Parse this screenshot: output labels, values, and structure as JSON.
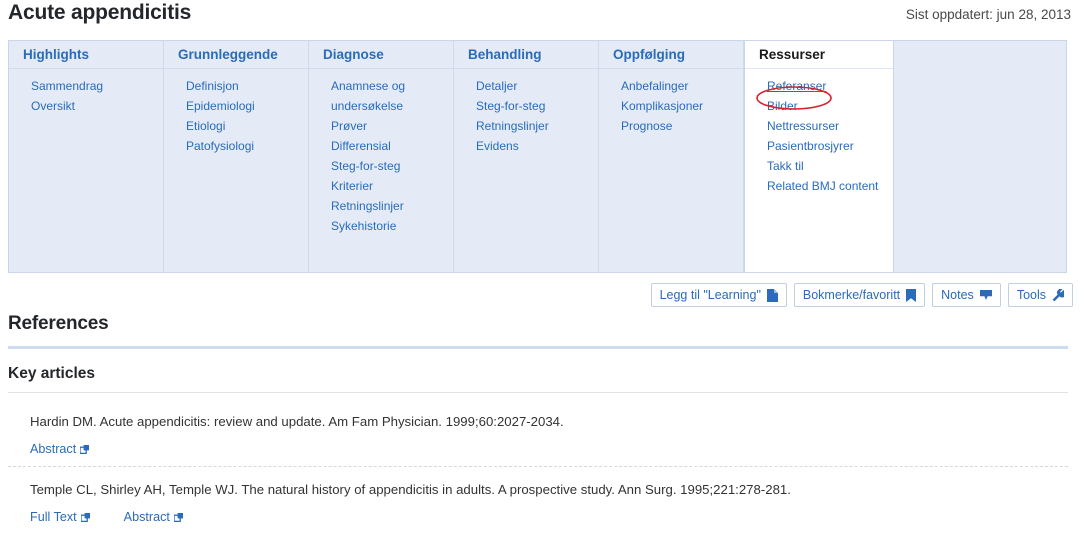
{
  "header": {
    "title": "Acute appendicitis",
    "last_updated": "Sist oppdatert: jun 28, 2013"
  },
  "nav_panel": {
    "columns": [
      {
        "heading": "Highlights",
        "active": false,
        "links": [
          "Sammendrag",
          "Oversikt"
        ]
      },
      {
        "heading": "Grunnleggende",
        "active": false,
        "links": [
          "Definisjon",
          "Epidemiologi",
          "Etiologi",
          "Patofysiologi"
        ]
      },
      {
        "heading": "Diagnose",
        "active": false,
        "links": [
          "Anamnese og",
          "undersøkelse",
          "Prøver",
          "Differensial",
          "Steg-for-steg",
          "Kriterier",
          "Retningslinjer",
          "Sykehistorie"
        ]
      },
      {
        "heading": "Behandling",
        "active": false,
        "links": [
          "Detaljer",
          "Steg-for-steg",
          "Retningslinjer",
          "Evidens"
        ]
      },
      {
        "heading": "Oppfølging",
        "active": false,
        "links": [
          "Anbefalinger",
          "Komplikasjoner",
          "Prognose"
        ]
      },
      {
        "heading": "Ressurser",
        "active": true,
        "links": [
          "Referanser",
          "Bilder",
          "Nettressurser",
          "Pasientbrosjyrer",
          "Takk til",
          "Related BMJ content"
        ],
        "current_link": "Referanser"
      }
    ],
    "annotation": {
      "shape": "red-ellipse",
      "target": "Referanser",
      "color": "#d81f2a"
    }
  },
  "action_bar": {
    "buttons": [
      {
        "label": "Legg til \"Learning\"",
        "icon": "document-icon"
      },
      {
        "label": "Bokmerke/favoritt",
        "icon": "bookmark-icon"
      },
      {
        "label": "Notes",
        "icon": "note-pin-icon"
      },
      {
        "label": "Tools",
        "icon": "wrench-icon"
      }
    ]
  },
  "content": {
    "section_title": "References",
    "sub_title": "Key articles",
    "references": [
      {
        "citation": "Hardin DM. Acute appendicitis: review and update. Am Fam Physician. 1999;60:2027-2034.",
        "links": [
          "Abstract"
        ]
      },
      {
        "citation": "Temple CL, Shirley AH, Temple WJ. The natural history of appendicitis in adults. A prospective study. Ann Surg. 1995;221:278-281.",
        "links": [
          "Full Text",
          "Abstract"
        ]
      }
    ]
  },
  "colors": {
    "link_blue": "#2a6bba",
    "panel_bg": "#e4ebf6",
    "rule_blue": "#cfdcf0",
    "annotation_red": "#d81f2a"
  }
}
